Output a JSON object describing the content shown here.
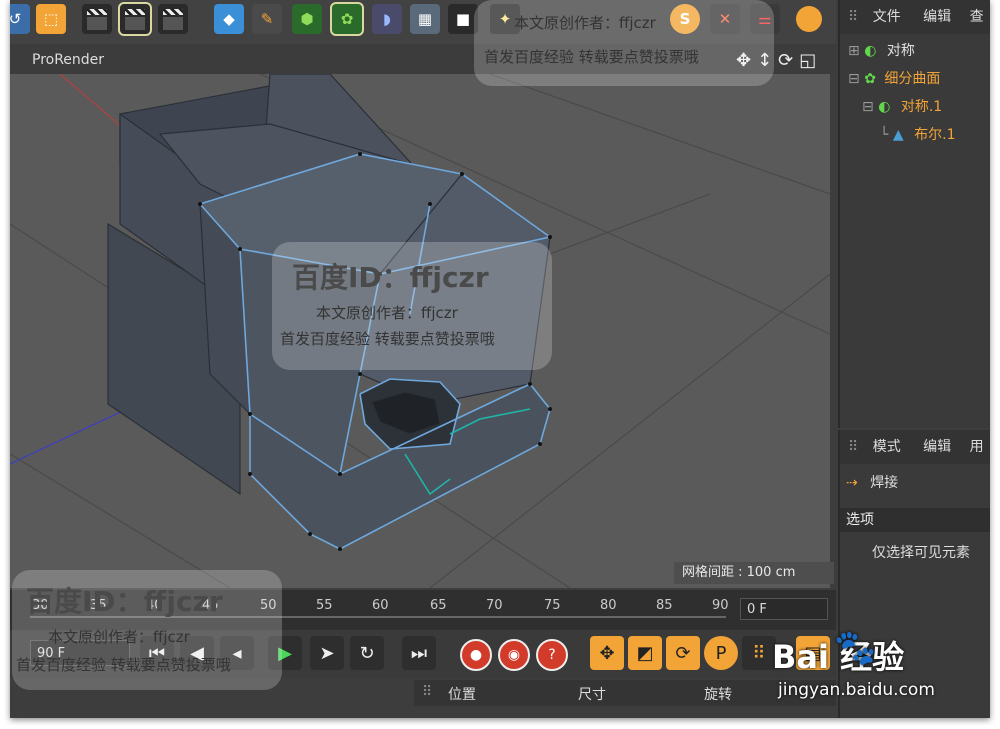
{
  "viewport": {
    "title": "ProRender",
    "grid_spacing": "网格间距 : 100 cm"
  },
  "timeline": {
    "ticks": [
      "30",
      "35",
      "40",
      "45",
      "50",
      "55",
      "60",
      "65",
      "70",
      "75",
      "80",
      "85",
      "90"
    ],
    "current_frame": "0 F",
    "end_frame": "90 F"
  },
  "coords": {
    "position": "位置",
    "size": "尺寸",
    "rotation": "旋转"
  },
  "object_manager": {
    "menu": [
      "文件",
      "编辑",
      "查"
    ],
    "objects": [
      {
        "label": "对称",
        "color": "#e0e0e0",
        "indent": 0
      },
      {
        "label": "细分曲面",
        "color": "#f2a437",
        "indent": 0
      },
      {
        "label": "对称.1",
        "color": "#f2a437",
        "indent": 1
      },
      {
        "label": "布尔.1",
        "color": "#f2a437",
        "indent": 2
      }
    ]
  },
  "attribute_manager": {
    "menu": [
      "模式",
      "编辑",
      "用"
    ],
    "tool_label": "焊接",
    "section_label": "选项",
    "option_label": "仅选择可见元素"
  },
  "watermarks": {
    "id": "百度ID：ffjczr",
    "author": "本文原创作者：ffjczr",
    "note": "首发百度经验 转载要点赞投票哦",
    "author_top": "本文原创作者：ffjczr",
    "note_top": "首发百度经验 转载要点赞投票哦",
    "brand": "Bai  经验",
    "brand_url": "jingyan.baidu.com"
  },
  "colors": {
    "accent": "#f2a437",
    "selection": "#6fa8dc",
    "viewport_bg": "#5a5a5a"
  }
}
